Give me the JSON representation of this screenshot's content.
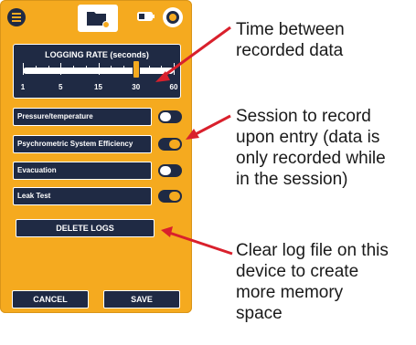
{
  "logging_rate": {
    "title": "LOGGING RATE (seconds)",
    "ticks": [
      "1",
      "5",
      "15",
      "30",
      "60"
    ],
    "selected": "30"
  },
  "sessions": [
    {
      "label": "Pressure/temperature",
      "enabled": false
    },
    {
      "label": "Psychrometric System Efficiency",
      "enabled": true
    },
    {
      "label": "Evacuation",
      "enabled": false
    },
    {
      "label": "Leak Test",
      "enabled": true
    }
  ],
  "buttons": {
    "delete_logs": "DELETE LOGS",
    "cancel": "CANCEL",
    "save": "SAVE"
  },
  "callouts": {
    "logging_rate": "Time between\nrecorded data",
    "sessions": "Session to record\nupon entry (data is\nonly recorded while\nin the session)",
    "delete_logs": "Clear log file on this\ndevice to create\nmore memory\nspace"
  },
  "colors": {
    "background": "#f5aa1f",
    "navy": "#1f2a44",
    "arrow": "#d9202c"
  },
  "icons": [
    "menu-icon",
    "folder-icon",
    "battery-icon",
    "record-icon"
  ]
}
